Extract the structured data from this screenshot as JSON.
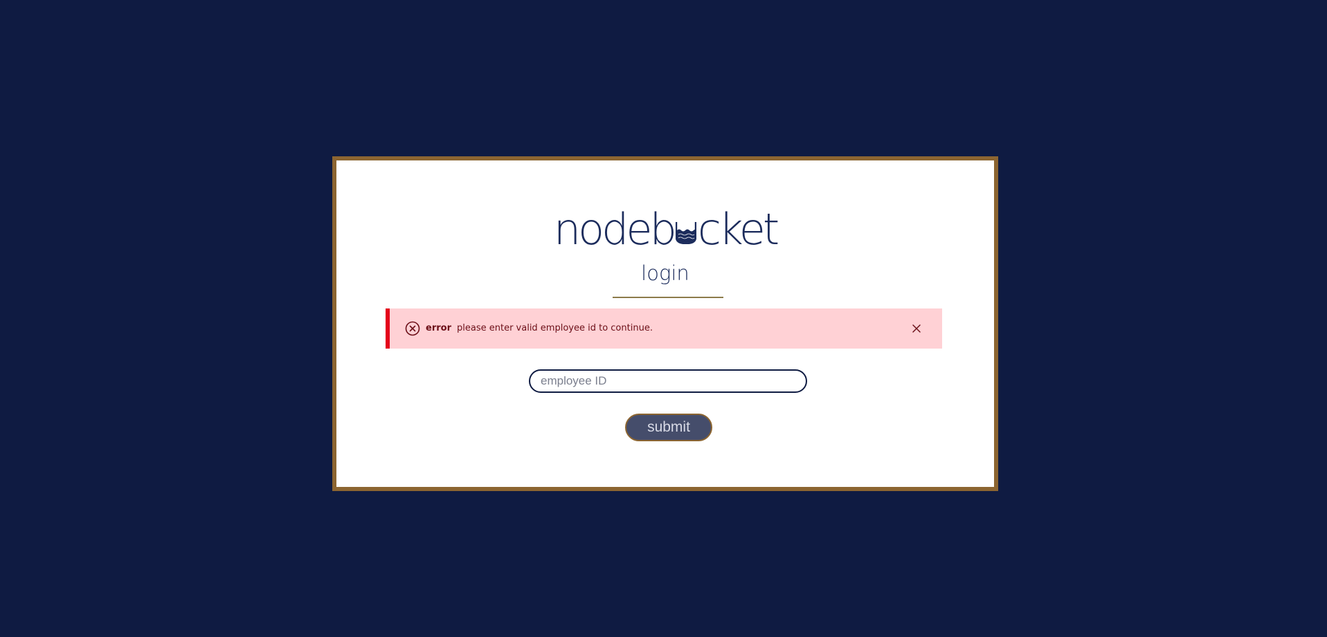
{
  "logo": {
    "text_before": "nodeb",
    "text_after": "cket",
    "icon": "bucket-icon"
  },
  "login": {
    "title": "login"
  },
  "error_banner": {
    "label": "error",
    "message": "please enter valid employee id to continue.",
    "icon": "error-circle-x-icon",
    "close_icon": "close-icon"
  },
  "form": {
    "employee_id_placeholder": "employee ID",
    "employee_id_value": "",
    "submit_label": "submit"
  },
  "colors": {
    "page_background": "#0f1b42",
    "card_border": "#8c6531",
    "brand_navy": "#1c2c5c",
    "error_background": "#ffd1d5",
    "error_accent": "#e4001b",
    "error_text": "#6c0e17",
    "button_fill": "#454d6b"
  }
}
